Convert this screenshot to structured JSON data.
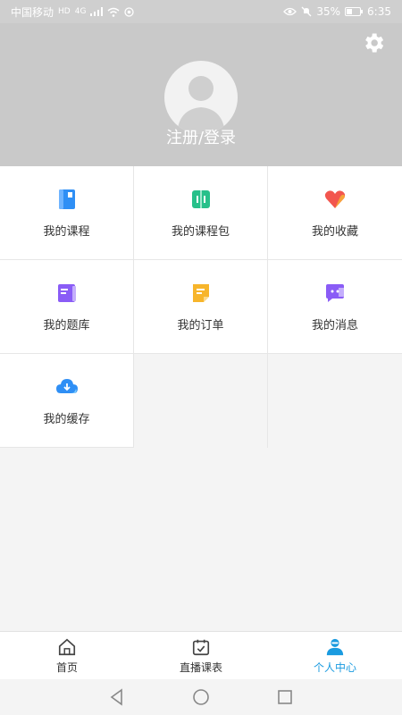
{
  "status_bar": {
    "carrier": "中国移动",
    "hd_badge": "HD",
    "network": "4G",
    "battery": "35%",
    "time": "6:35"
  },
  "header": {
    "login_text": "注册/登录",
    "settings_icon": "gear-icon",
    "avatar_icon": "default-avatar-icon"
  },
  "menu": {
    "items": [
      {
        "label": "我的课程",
        "icon": "course-book-icon",
        "color": "#2f8ff5"
      },
      {
        "label": "我的课程包",
        "icon": "course-package-icon",
        "color": "#27c08a"
      },
      {
        "label": "我的收藏",
        "icon": "heart-icon",
        "color": "#f2564e"
      },
      {
        "label": "我的题库",
        "icon": "question-bank-icon",
        "color": "#8a5cf6"
      },
      {
        "label": "我的订单",
        "icon": "order-icon",
        "color": "#f7b52b"
      },
      {
        "label": "我的消息",
        "icon": "message-icon",
        "color": "#8a5cf6"
      },
      {
        "label": "我的缓存",
        "icon": "cloud-download-icon",
        "color": "#2f8ff5"
      }
    ]
  },
  "tab_bar": {
    "tabs": [
      {
        "label": "首页",
        "icon": "home-icon"
      },
      {
        "label": "直播课表",
        "icon": "calendar-icon"
      },
      {
        "label": "个人中心",
        "icon": "person-icon",
        "active": true
      }
    ],
    "active_color": "#1a9be0"
  },
  "nav_bar": {
    "back": "back-icon",
    "home": "home-circle-icon",
    "recents": "recents-icon"
  }
}
